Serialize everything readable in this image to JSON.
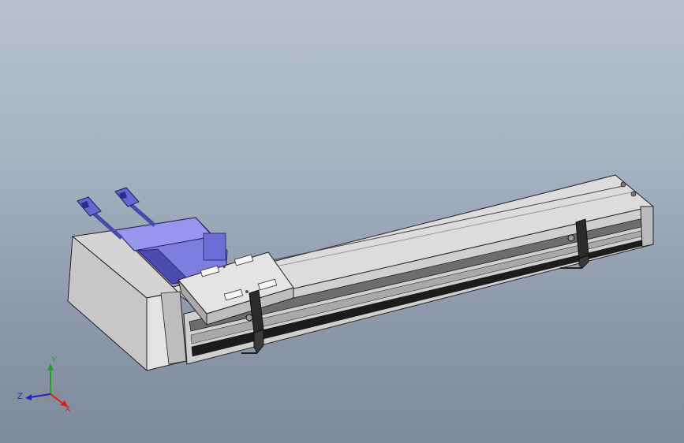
{
  "triad": {
    "x_label": "X",
    "y_label": "Y",
    "z_label": "Z",
    "colors": {
      "x": "#d42020",
      "y": "#1fa81f",
      "z": "#2323c8"
    }
  },
  "model": {
    "motor_color": "#7a78d6",
    "body_color": "#d8d8d8",
    "shadow_color": "#4a4a4a"
  }
}
